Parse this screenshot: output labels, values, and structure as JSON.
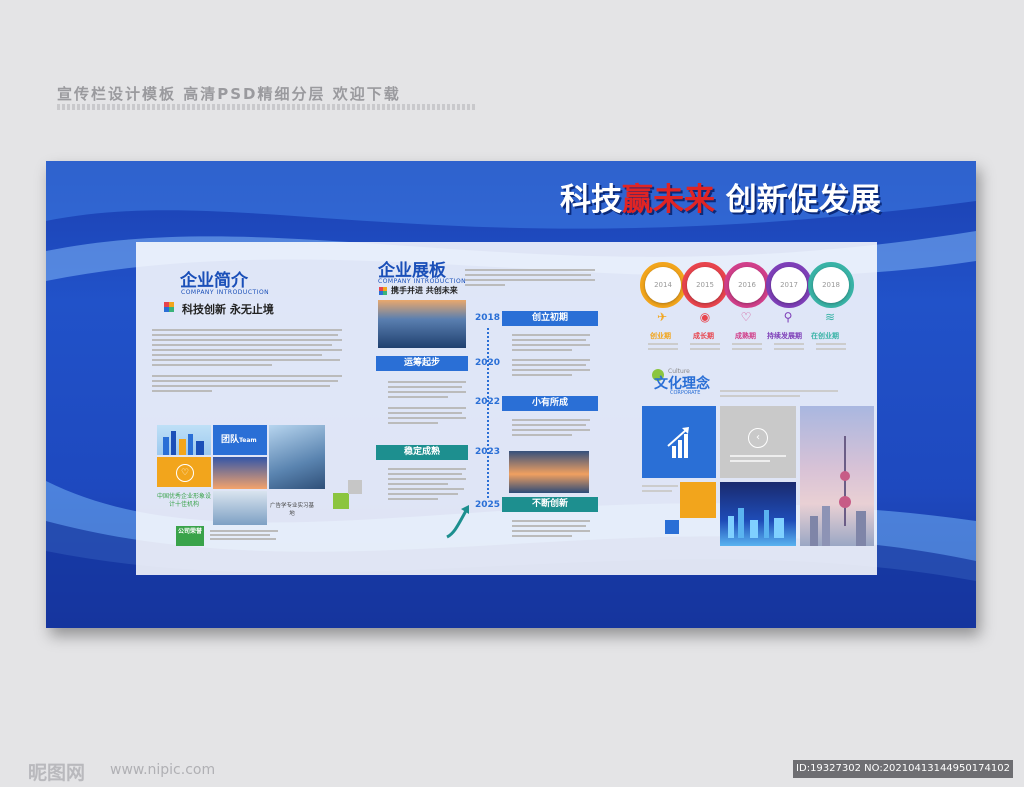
{
  "caption": "宣传栏设计模板 高清PSD精细分层 欢迎下载",
  "slogan": {
    "part1": "科技",
    "part2": "赢未来",
    "part3": " 创新促发展"
  },
  "intro": {
    "title": "企业简介",
    "en": "COMPANY INTRODUCTION",
    "motto": "科技创新 永无止境",
    "team_label": "团队",
    "team_en": "Team",
    "award_text": "中国优秀企业形象设计十佳机构",
    "base_text": "广告学专业实习基地",
    "honor_label": "公司荣誉"
  },
  "board": {
    "title": "企业展板",
    "en": "COMPANY INTRODUCTION",
    "motto": "携手并进 共创未来",
    "milestones": [
      {
        "year": "2018",
        "label": "创立初期"
      },
      {
        "year": "2020",
        "label": "运筹起步"
      },
      {
        "year": "2022",
        "label": "小有所成"
      },
      {
        "year": "2023",
        "label": "稳定成熟"
      },
      {
        "year": "2025",
        "label": "不断创新"
      }
    ]
  },
  "growth": {
    "years": [
      "2014",
      "2015",
      "2016",
      "2017",
      "2018"
    ],
    "stages": [
      "创业期",
      "成长期",
      "成熟期",
      "持续发展期",
      "在创业期"
    ],
    "colors": [
      "#f2a51c",
      "#e8444d",
      "#d13f8a",
      "#7e3fb8",
      "#39b3a6"
    ]
  },
  "culture": {
    "title": "文化理念",
    "small": "Culture",
    "en": "CORPORATE"
  },
  "footer": {
    "logo": "昵图网",
    "url": "www.nipic.com",
    "id": "ID:19327302 NO:20210413144950174102"
  }
}
